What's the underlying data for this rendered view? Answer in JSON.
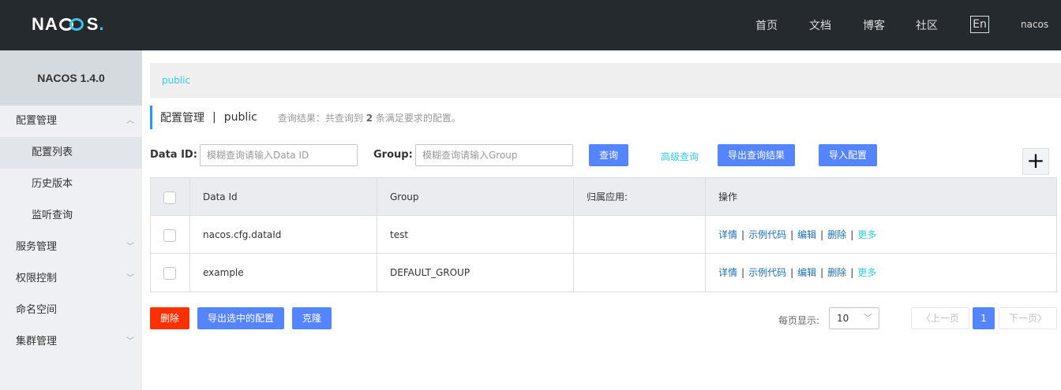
{
  "header": {
    "logo_text_a": "NA",
    "logo_text_b": "S",
    "logo_dot": ".",
    "nav": [
      "首页",
      "文档",
      "博客",
      "社区"
    ],
    "lang": "En",
    "user": "nacos"
  },
  "sidebar": {
    "title": "NACOS 1.4.0",
    "items": [
      {
        "label": "配置管理",
        "expanded": true
      },
      {
        "label": "配置列表"
      },
      {
        "label": "历史版本"
      },
      {
        "label": "监听查询"
      },
      {
        "label": "服务管理"
      },
      {
        "label": "权限控制"
      },
      {
        "label": "命名空间"
      },
      {
        "label": "集群管理"
      }
    ]
  },
  "namespace": {
    "current": "public"
  },
  "page": {
    "title": "配置管理",
    "separator": "|",
    "namespace": "public",
    "summary_pre": "查询结果：共查询到",
    "summary_count": "2",
    "summary_post": "条满足要求的配置。"
  },
  "search": {
    "dataid_label": "Data ID:",
    "dataid_placeholder": "模糊查询请输入Data ID",
    "group_label": "Group:",
    "group_placeholder": "模糊查询请输入Group",
    "query_label": "查询",
    "advanced_label": "高级查询",
    "export_label": "导出查询结果",
    "import_label": "导入配置",
    "add_symbol": "+"
  },
  "table": {
    "columns": [
      "Data Id",
      "Group",
      "归属应用:",
      "操作"
    ],
    "rows": [
      {
        "data_id": "nacos.cfg.dataId",
        "group": "test",
        "app": ""
      },
      {
        "data_id": "example",
        "group": "DEFAULT_GROUP",
        "app": ""
      }
    ],
    "ops": {
      "detail": "详情",
      "sample": "示例代码",
      "edit": "编辑",
      "delete": "删除",
      "more": "更多",
      "sep": "|"
    }
  },
  "footer": {
    "delete_label": "删除",
    "export_selected_label": "导出选中的配置",
    "clone_label": "克隆",
    "page_size_label": "每页显示:",
    "page_size": "10",
    "prev_label": "上一页",
    "next_label": "下一页",
    "current_page": "1"
  }
}
